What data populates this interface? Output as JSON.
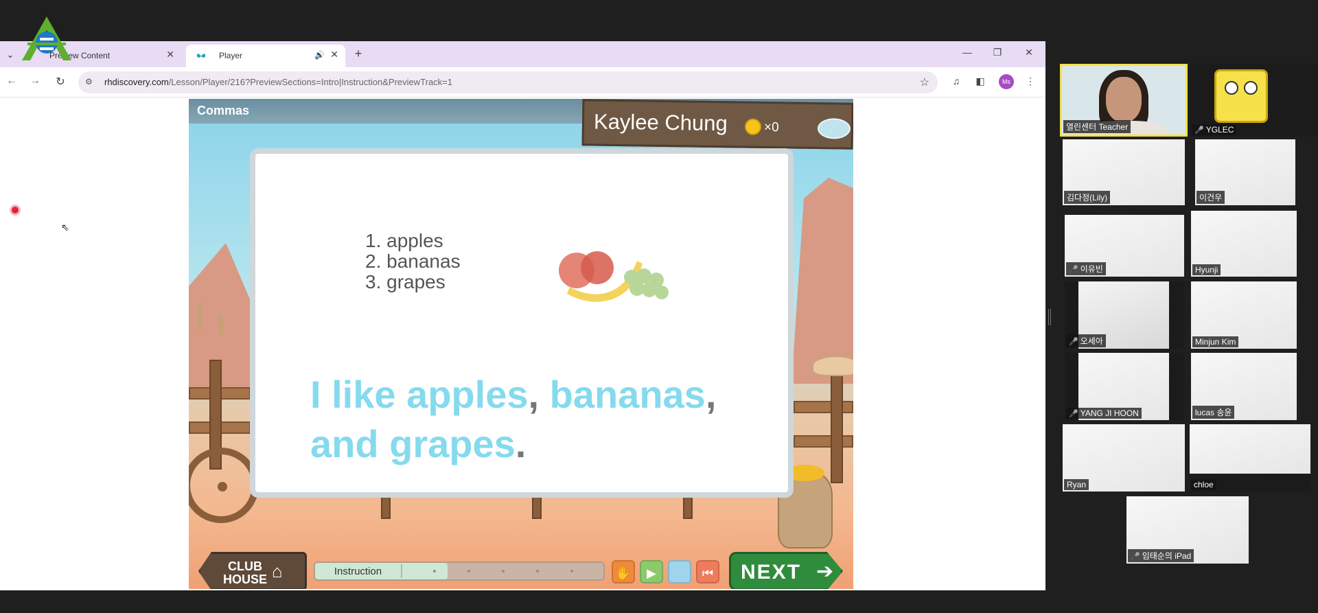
{
  "browser": {
    "tabs": [
      {
        "title": "Preview Content",
        "active": false
      },
      {
        "title": "Player",
        "active": true
      }
    ],
    "url_host": "rhdiscovery.com",
    "url_path": "/Lesson/Player/216?PreviewSections=Intro|Instruction&PreviewTrack=1",
    "profile_initials": "Ms"
  },
  "lesson": {
    "title": "Commas",
    "student_name": "Kaylee Chung",
    "coin_count": "×0",
    "list_items": [
      "1. apples",
      "2. bananas",
      "3. grapes"
    ],
    "sentence_parts": [
      {
        "text": "I like apples",
        "kind": "word"
      },
      {
        "text": ",",
        "kind": "punct"
      },
      {
        "text": " bananas",
        "kind": "word"
      },
      {
        "text": ",",
        "kind": "punct"
      },
      {
        "text": " and grapes",
        "kind": "word"
      },
      {
        "text": ".",
        "kind": "punct"
      }
    ],
    "clubhouse_label": "CLUB HOUSE",
    "progress_label": "Instruction",
    "progress_fraction": 0.46,
    "next_label": "NEXT"
  },
  "participants": [
    {
      "name": "열린센터 Teacher",
      "muted": false,
      "speaking": true
    },
    {
      "name": "YGLEC",
      "muted": true,
      "speaking": false
    },
    {
      "name": "김다정(Lily)",
      "muted": false,
      "speaking": false
    },
    {
      "name": "이건우",
      "muted": false,
      "speaking": false
    },
    {
      "name": "이유빈",
      "muted": true,
      "speaking": false
    },
    {
      "name": "Hyunji",
      "muted": false,
      "speaking": false
    },
    {
      "name": "오세아",
      "muted": true,
      "speaking": false
    },
    {
      "name": "Minjun Kim",
      "muted": false,
      "speaking": false
    },
    {
      "name": "YANG JI HOON",
      "muted": true,
      "speaking": false
    },
    {
      "name": "lucas 송윤",
      "muted": false,
      "speaking": false
    },
    {
      "name": "Ryan",
      "muted": false,
      "speaking": false
    },
    {
      "name": "chloe",
      "muted": false,
      "speaking": false
    },
    {
      "name": "임태순의 iPad",
      "muted": true,
      "speaking": false
    }
  ],
  "colors": {
    "tab_strip": "#e8dcf5",
    "sentence_blue": "#85daee",
    "next_green": "#2f8c3c",
    "speaker_highlight": "#f7e14b"
  },
  "icons": {
    "audio": "🔊",
    "mute": "🎤",
    "star": "☆"
  }
}
